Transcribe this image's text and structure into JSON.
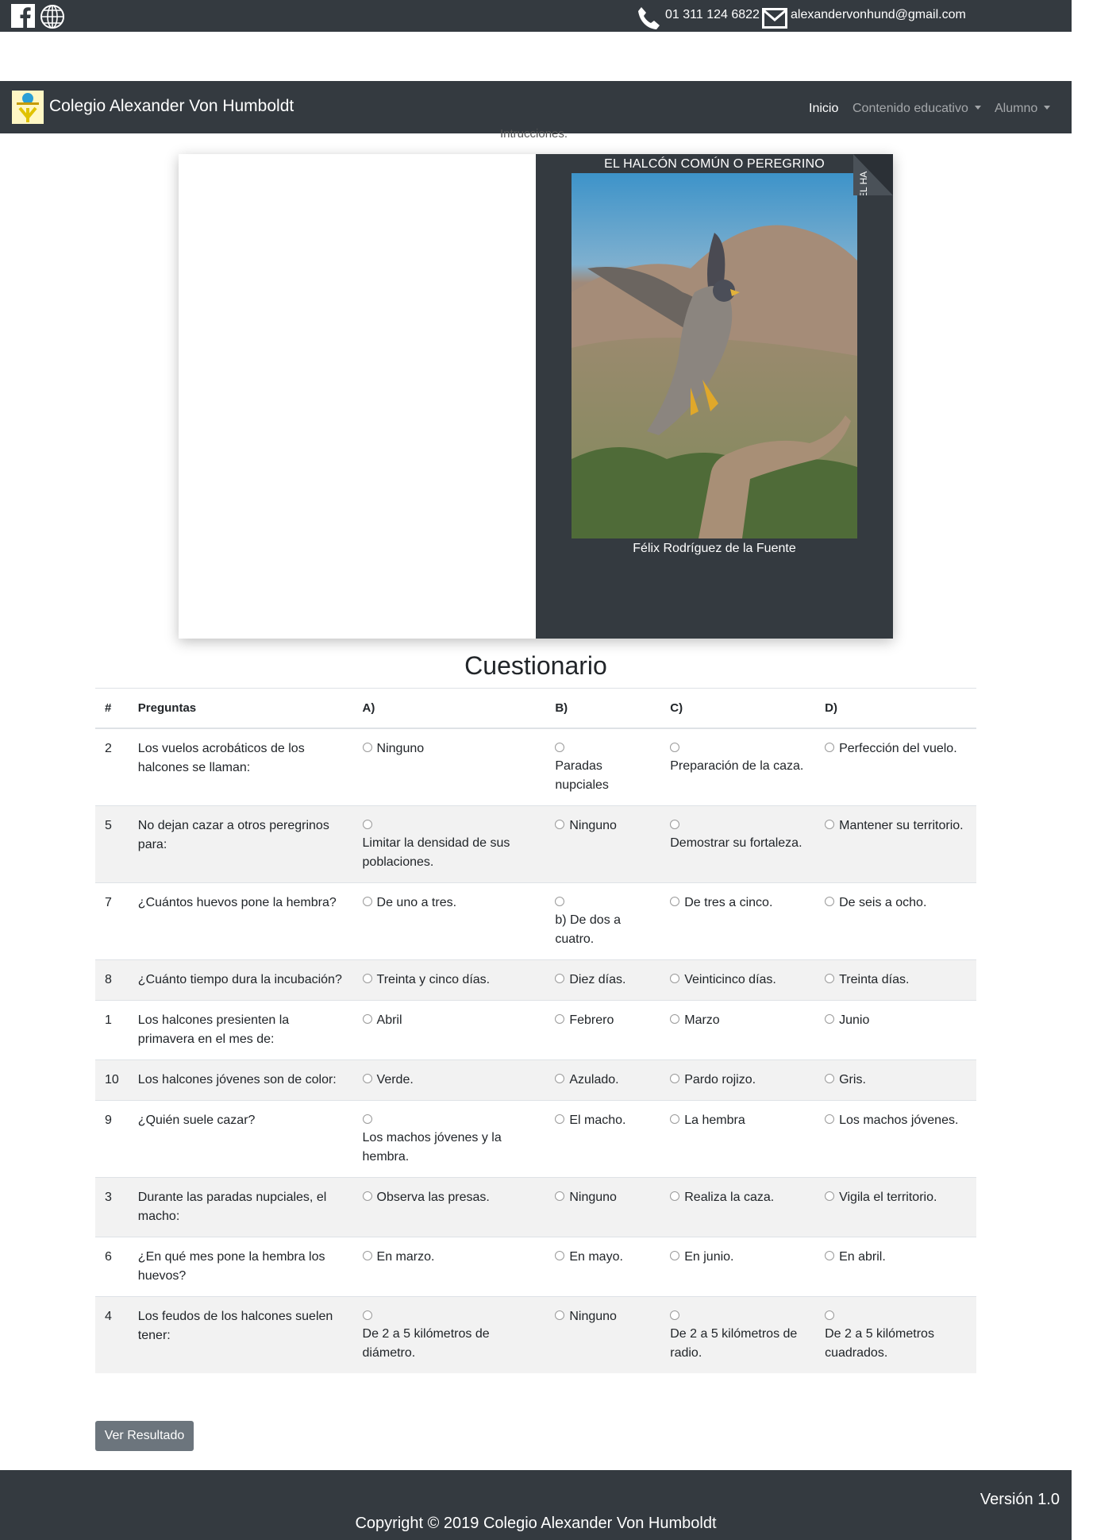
{
  "topbar": {
    "phone": "01 311 124 6822",
    "email": "alexandervonhund@gmail.com",
    "icons": [
      "facebook-icon",
      "globe-icon",
      "phone-icon",
      "mail-icon"
    ]
  },
  "navbar": {
    "brand": "Colegio Alexander Von Humboldt",
    "items": [
      {
        "label": "Inicio",
        "active": true
      },
      {
        "label": "Contenido educativo",
        "dropdown": true
      },
      {
        "label": "Alumno",
        "dropdown": true
      }
    ]
  },
  "instructions_label": "Intrucciones.",
  "book": {
    "title": "EL HALCÓN COMÚN O PEREGRINO",
    "author": "Félix Rodríguez de la Fuente",
    "corner_text": "EL HA"
  },
  "quiz": {
    "title": "Cuestionario",
    "headers": [
      "#",
      "Preguntas",
      "A)",
      "B)",
      "C)",
      "D)"
    ],
    "rows": [
      {
        "num": "2",
        "question": "Los vuelos acrobáticos de los halcones se llaman:",
        "a": "Ninguno",
        "b": "Paradas nupciales",
        "c": "Preparación de la caza.",
        "d": "Perfección del vuelo."
      },
      {
        "num": "5",
        "question": "No dejan cazar a otros peregrinos para:",
        "a": "Limitar la densidad de sus poblaciones.",
        "b": "Ninguno",
        "c": "Demostrar su fortaleza.",
        "d": "Mantener su territorio."
      },
      {
        "num": "7",
        "question": "¿Cuántos huevos pone la hembra?",
        "a": "De uno a tres.",
        "b": "b) De dos a cuatro.",
        "c": "De tres a cinco.",
        "d": "De seis a ocho."
      },
      {
        "num": "8",
        "question": "¿Cuánto tiempo dura la incubación?",
        "a": "Treinta y cinco días.",
        "b": "Diez días.",
        "c": "Veinticinco días.",
        "d": "Treinta días."
      },
      {
        "num": "1",
        "question": "Los halcones presienten la primavera en el mes de:",
        "a": "Abril",
        "b": "Febrero",
        "c": "Marzo",
        "d": "Junio"
      },
      {
        "num": "10",
        "question": "Los halcones jóvenes son de color:",
        "a": "Verde.",
        "b": "Azulado.",
        "c": "Pardo rojizo.",
        "d": "Gris."
      },
      {
        "num": "9",
        "question": "¿Quién suele cazar?",
        "a": "Los machos jóvenes y la hembra.",
        "b": "El macho.",
        "c": "La hembra",
        "d": "Los machos jóvenes."
      },
      {
        "num": "3",
        "question": "Durante las paradas nupciales, el macho:",
        "a": "Observa las presas.",
        "b": "Ninguno",
        "c": "Realiza la caza.",
        "d": "Vigila el territorio."
      },
      {
        "num": "6",
        "question": "¿En qué mes pone la hembra los huevos?",
        "a": "En marzo.",
        "b": "En mayo.",
        "c": "En junio.",
        "d": "En abril."
      },
      {
        "num": "4",
        "question": "Los feudos de los halcones suelen tener:",
        "a": "De 2 a 5 kilómetros de diámetro.",
        "b": "Ninguno",
        "c": "De 2 a 5 kilómetros de radio.",
        "d": "De 2 a 5 kilómetros cuadrados."
      }
    ],
    "submit_label": "Ver Resultado"
  },
  "footer": {
    "version": "Versión 1.0",
    "copyright": "Copyright © 2019 Colegio Alexander Von Humboldt"
  },
  "colors": {
    "dark": "#343a40",
    "button": "#6c757d",
    "stripe": "#f2f2f2"
  }
}
